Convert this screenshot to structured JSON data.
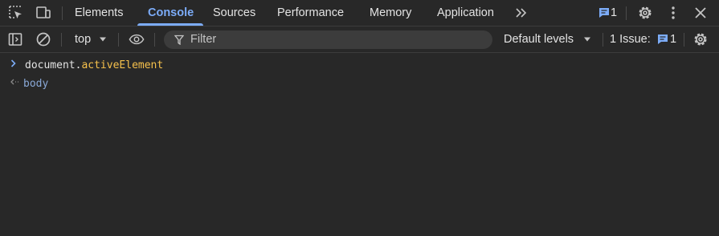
{
  "tabs": [
    {
      "label": "Elements",
      "active": false
    },
    {
      "label": "Console",
      "active": true
    },
    {
      "label": "Sources",
      "active": false
    },
    {
      "label": "Performance",
      "active": false
    },
    {
      "label": "Memory",
      "active": false
    },
    {
      "label": "Application",
      "active": false
    }
  ],
  "header": {
    "issues_count": "1"
  },
  "toolbar": {
    "context": "top",
    "filter_placeholder": "Filter",
    "levels": "Default levels",
    "issues_label": "1 Issue:",
    "issues_count": "1"
  },
  "console": {
    "input": {
      "object": "document",
      "dot": ".",
      "property": "activeElement"
    },
    "result": "body"
  },
  "colors": {
    "background": "#282828",
    "accent": "#7cacf8",
    "property": "#f6c14c",
    "result": "#8aa9d8"
  }
}
